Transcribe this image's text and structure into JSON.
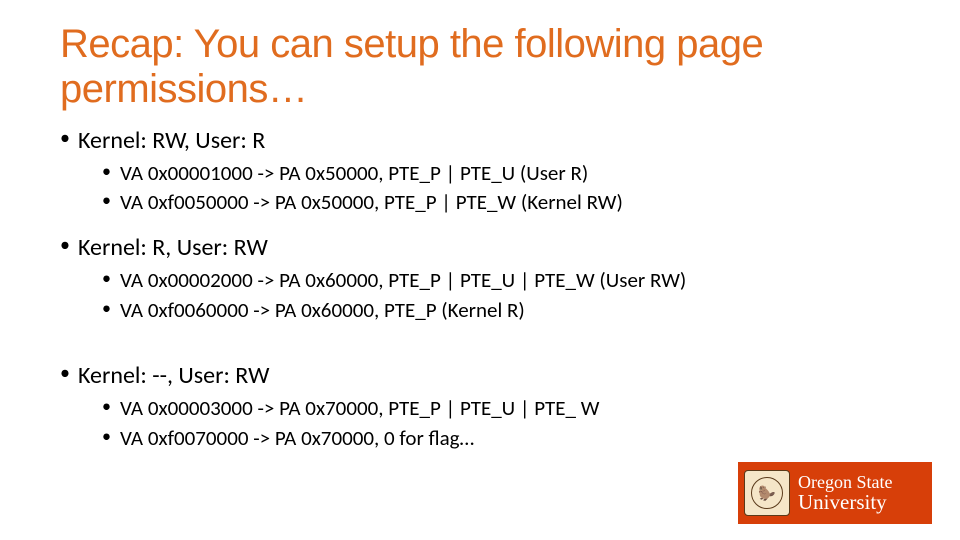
{
  "title": "Recap: You can setup the following page permissions…",
  "bullets": [
    {
      "text": "Kernel: RW, User: R",
      "sub": [
        "VA 0x00001000 -> PA 0x50000, PTE_P | PTE_U (User R)",
        "VA 0xf0050000 -> PA 0x50000, PTE_P | PTE_W (Kernel RW)"
      ]
    },
    {
      "text": "Kernel: R, User: RW",
      "sub": [
        "VA 0x00002000 -> PA 0x60000, PTE_P | PTE_U | PTE_W (User RW)",
        "VA 0xf0060000 -> PA 0x60000, PTE_P (Kernel R)"
      ]
    },
    {
      "text": "Kernel: --, User: RW",
      "sub": [
        "VA 0x00003000 -> PA 0x70000, PTE_P | PTE_U | PTE_ W",
        "VA 0xf0070000 -> PA 0x70000, 0 for flag…"
      ],
      "spacer_before": true
    }
  ],
  "logo": {
    "line1": "Oregon State",
    "line2": "University",
    "seal_glyph": "🦫"
  }
}
